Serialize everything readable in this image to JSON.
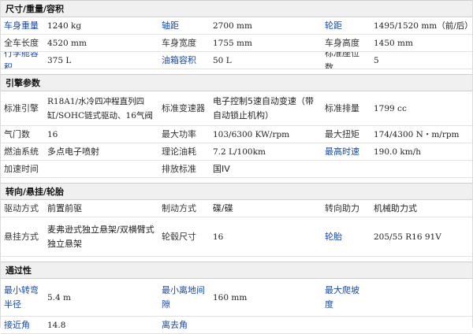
{
  "sections": {
    "size": {
      "title": "尺寸/重量/容积",
      "rows": [
        [
          "车身重量",
          "1240 kg",
          "轴距",
          "2700 mm",
          "轮距",
          "1495/1520 mm（前/后）"
        ],
        [
          "全车长度",
          "4520 mm",
          "车身宽度",
          "1755 mm",
          "车身高度",
          "1450 mm"
        ],
        [
          "行李舱容积",
          "375 L",
          "油箱容积",
          "50 L",
          "标准座位数",
          "5"
        ]
      ]
    },
    "engine": {
      "title": "引擎参数",
      "rows": [
        [
          "标准引擎",
          "R18A1/水冷四冲程直列四缸/SOHC链式驱动、16气阀",
          "标准变速器",
          "电子控制5速自动变速（带自动锁止机构）",
          "标准排量",
          "1799 cc"
        ],
        [
          "气门数",
          "16",
          "最大功率",
          "103/6300 KW/rpm",
          "最大扭矩",
          "174/4300 N・m/rpm"
        ],
        [
          "燃油系统",
          "多点电子喷射",
          "理论油耗",
          "7.2 L/100km",
          "最高时速",
          "190.0 km/h"
        ],
        [
          "加速时间",
          "",
          "排放标准",
          "国IV",
          "",
          ""
        ]
      ]
    },
    "steering": {
      "title": "转向/悬挂/轮胎",
      "rows": [
        [
          "驱动方式",
          "前置前驱",
          "制动方式",
          "碟/碟",
          "转向助力",
          "机械助力式"
        ],
        [
          "悬挂方式",
          "麦弗逊式独立悬架/双横臂式独立悬架",
          "轮毂尺寸",
          "16",
          "轮胎",
          "205/55 R16 91V"
        ]
      ]
    },
    "passability": {
      "title": "通过性",
      "rows": [
        [
          "最小转弯半径",
          "5.4 m",
          "最小离地间隙",
          "160 mm",
          "最大爬坡度",
          ""
        ],
        [
          "接近角",
          "14.8",
          "离去角",
          "",
          "",
          ""
        ]
      ]
    }
  }
}
